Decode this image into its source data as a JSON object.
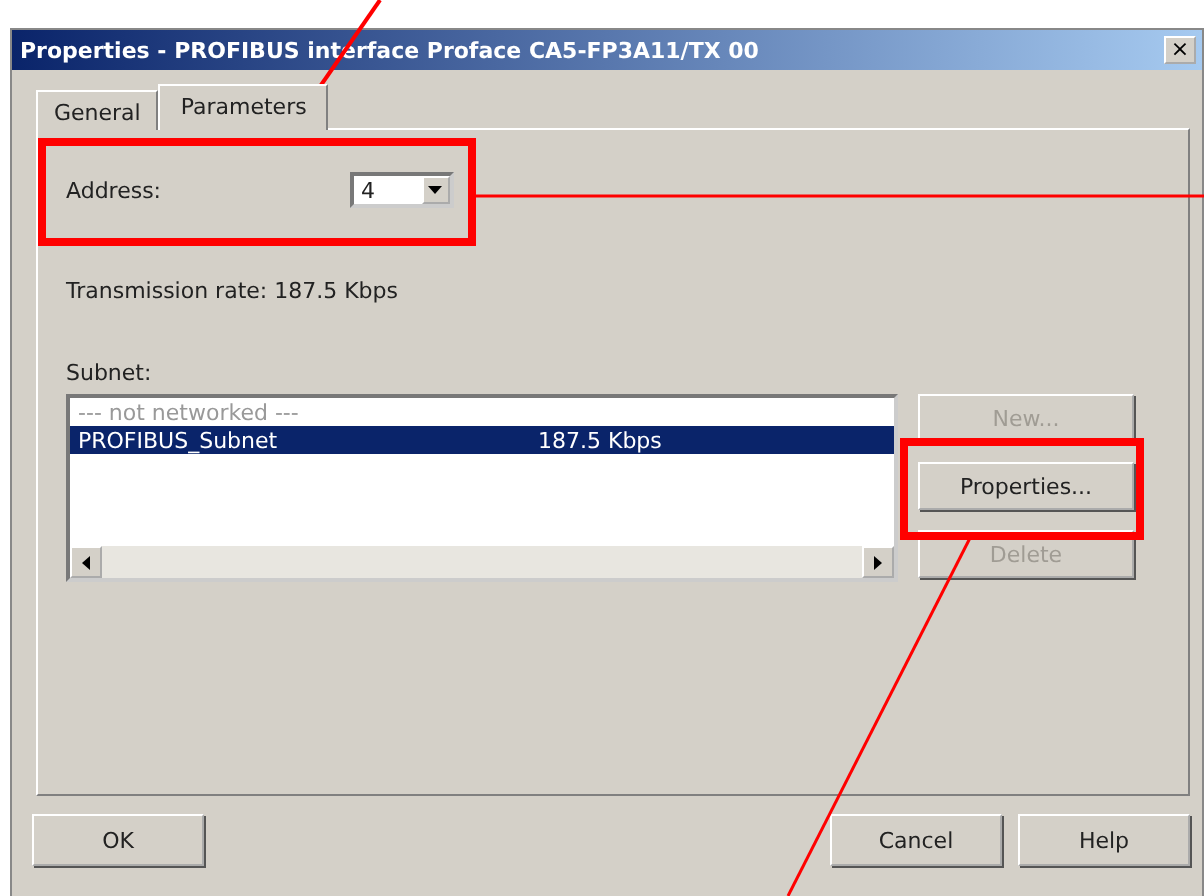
{
  "window": {
    "title": "Properties - PROFIBUS interface Proface CA5-FP3A11/TX 00",
    "close": "×"
  },
  "tabs": [
    {
      "label": "General",
      "selected": false
    },
    {
      "label": "Parameters",
      "selected": true
    }
  ],
  "address": {
    "label": "Address:",
    "value": "4"
  },
  "transmission_rate": "Transmission rate: 187.5 Kbps",
  "subnet": {
    "label": "Subnet:",
    "rows": [
      {
        "name": "--- not networked ---",
        "rate": "",
        "selected": false
      },
      {
        "name": "PROFIBUS_Subnet",
        "rate": "187.5 Kbps",
        "selected": true
      }
    ]
  },
  "side_buttons": [
    {
      "label": "New...",
      "disabled": true
    },
    {
      "label": "Properties...",
      "disabled": false
    },
    {
      "label": "Delete",
      "disabled": true
    }
  ],
  "footer_buttons": [
    "OK",
    "Cancel",
    "Help"
  ]
}
